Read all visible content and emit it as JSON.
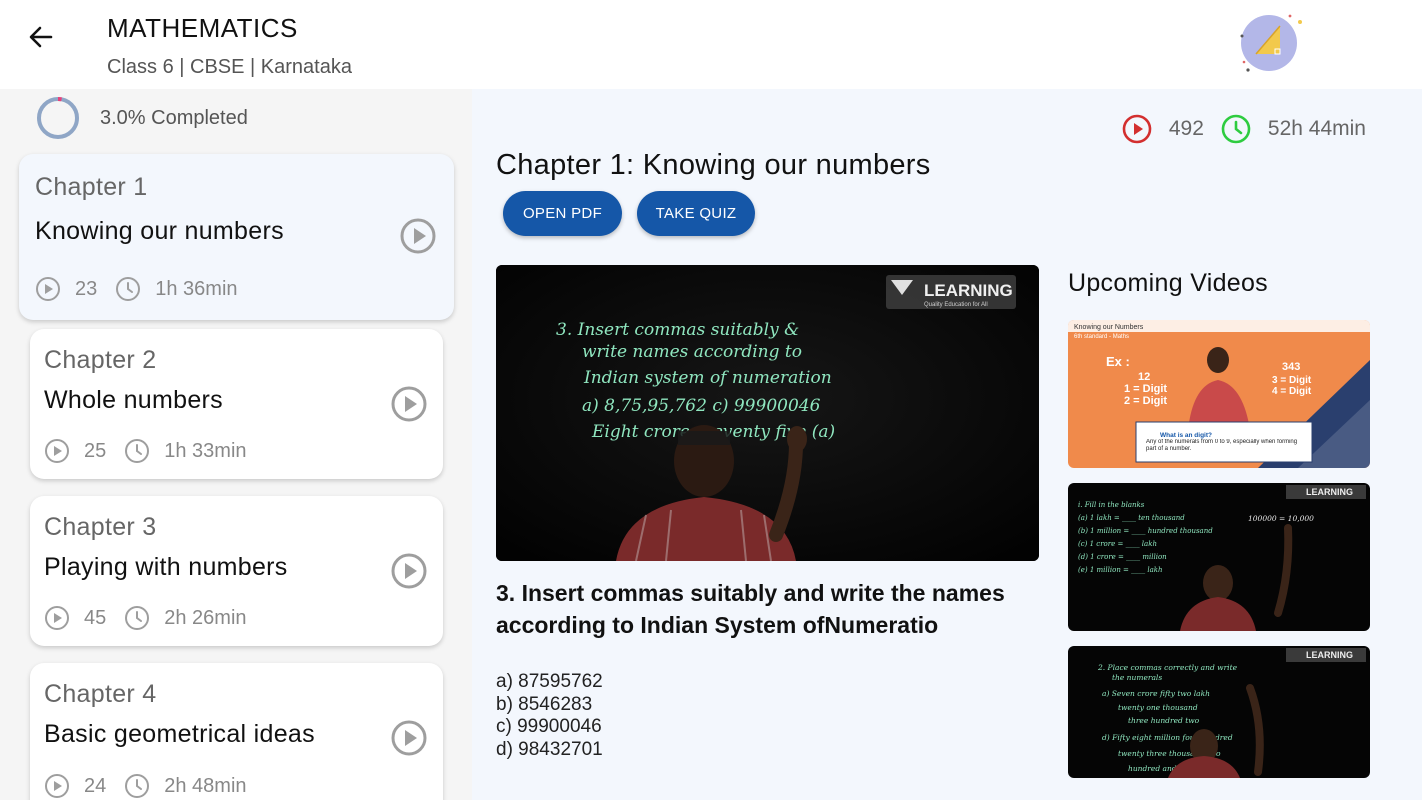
{
  "header": {
    "title": "MATHEMATICS",
    "subtitle": "Class 6 | CBSE | Karnataka",
    "back_icon": "arrow-left-icon",
    "logo_icon": "geometry-triangle-logo"
  },
  "progress": {
    "text": "3.0% Completed",
    "fraction": 0.03,
    "color": "#e8407a"
  },
  "chapters": [
    {
      "number": "Chapter 1",
      "name": "Knowing our numbers",
      "videos": "23",
      "duration": "1h 36min",
      "active": true
    },
    {
      "number": "Chapter 2",
      "name": "Whole numbers",
      "videos": "25",
      "duration": "1h 33min"
    },
    {
      "number": "Chapter 3",
      "name": "Playing with numbers",
      "videos": "45",
      "duration": "2h 26min"
    },
    {
      "number": "Chapter 4",
      "name": "Basic geometrical ideas",
      "videos": "24",
      "duration": "2h 48min"
    }
  ],
  "main": {
    "stats": {
      "videos": "492",
      "duration": "52h 44min"
    },
    "chapter_title": "Chapter 1: Knowing our numbers",
    "open_pdf_label": "OPEN PDF",
    "take_quiz_label": "TAKE QUIZ",
    "video": {
      "brand": "LEARNING",
      "brand_tagline": "Quality Education for All",
      "board_lines": [
        "3. Insert commas suitably &",
        "write names according to",
        "Indian system of numeration",
        "a) 8,75,95,762      c) 99900046",
        "Eight crores seventy five (a)"
      ]
    },
    "question": "3. Insert commas suitably and write the names according to Indian System ofNumeratio",
    "options": [
      "a) 87595762",
      "b) 8546283",
      "c) 99900046",
      "d) 98432701"
    ],
    "upcoming_title": "Upcoming Videos",
    "upcoming": [
      {
        "header": "Knowing our Numbers",
        "subheader": "6th standard - Maths",
        "left_text": [
          "Ex :",
          "12",
          "1 = Digit",
          "2 = Digit"
        ],
        "right_text": [
          "343",
          "3 = Digit",
          "4 = Digit"
        ],
        "caption_title": "What is an digit?",
        "caption_body": "Any of the numerals from 0 to 9, especially when forming part of a number."
      },
      {
        "brand": "LEARNING",
        "lines": [
          "i. Fill in the blanks",
          "(a) 1 lakh = ____ ten thousand",
          "(b) 1 million = ____ hundred thousand",
          "(c) 1 crore = ____ lakh",
          "(d) 1 crore = ____ million",
          "(e) 1 million = ____ lakh"
        ],
        "side_note": "100000 = 10,000"
      },
      {
        "brand": "LEARNING",
        "lines": [
          "2. Place commas correctly and write",
          "the numerals",
          "a) Seven crore fifty two lakh",
          "twenty one thousand",
          "three hundred two",
          "d) Fifty eight million four hundred",
          "twenty three thousand two",
          "hundred and two"
        ]
      }
    ]
  },
  "colors": {
    "accent": "#1557a8",
    "play_red": "#d32f2f",
    "clock_green": "#2ecc40",
    "chalk_green": "#7fe0b0",
    "orange": "#f08a4b",
    "navy": "#2a3f6e"
  }
}
